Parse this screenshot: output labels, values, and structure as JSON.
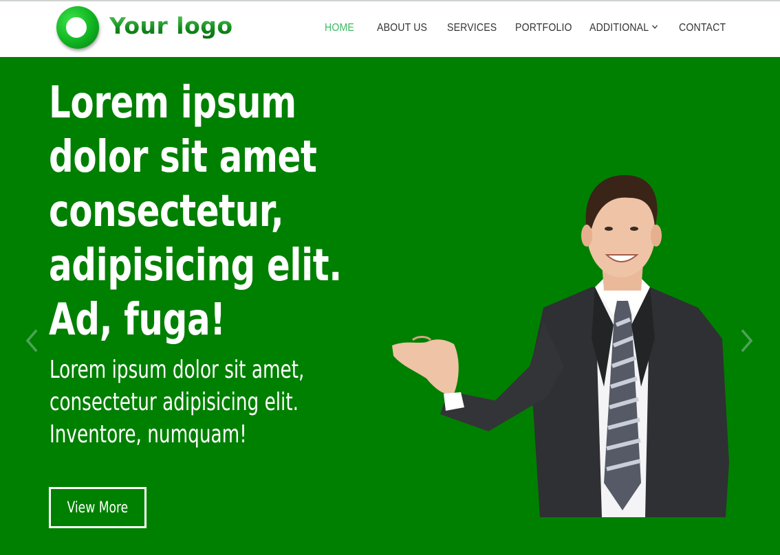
{
  "header": {
    "logo_text": "Your logo",
    "nav": [
      {
        "label": "HOME",
        "active": true
      },
      {
        "label": "ABOUT US",
        "active": false
      },
      {
        "label": "SERVICES",
        "active": false
      },
      {
        "label": "PORTFOLIO",
        "active": false
      },
      {
        "label": "ADDITIONAL",
        "active": false,
        "has_dropdown": true
      },
      {
        "label": "CONTACT",
        "active": false
      }
    ]
  },
  "hero": {
    "title": "Lorem ipsum dolor sit amet consectetur, adipisicing elit. Ad, fuga!",
    "subtitle": "Lorem ipsum dolor sit amet, consectetur adipisicing elit. Inventore, numquam!",
    "button_label": "View More"
  },
  "icons": {
    "prev": "chevron-left-icon",
    "next": "chevron-right-icon",
    "dropdown": "chevron-down-icon"
  },
  "colors": {
    "hero_background": "#008000",
    "nav_active": "#3dbb63",
    "nav_text": "#333333",
    "logo_green": "#0fb31f"
  }
}
